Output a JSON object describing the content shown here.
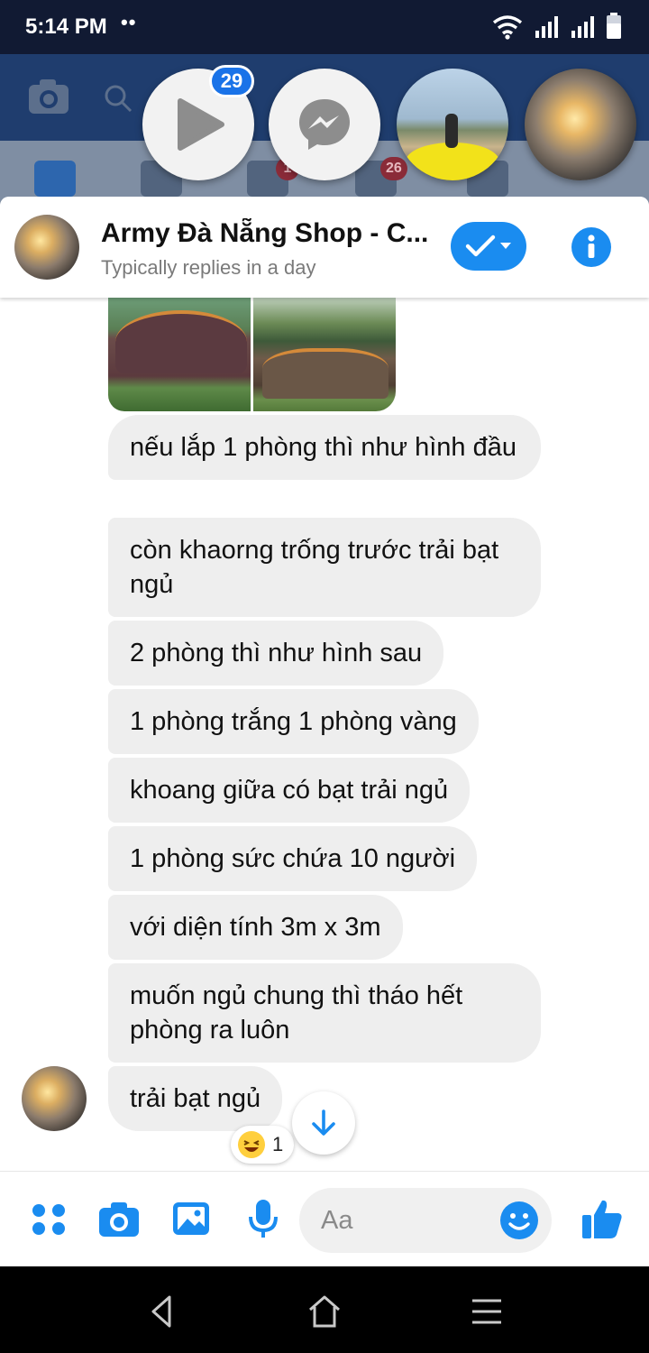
{
  "status_bar": {
    "time": "5:14 PM",
    "dots": "••"
  },
  "chat_heads": {
    "video_badge": "29"
  },
  "fb_tabs": {
    "badge_video": "",
    "badge_market": "1",
    "badge_notif": "26"
  },
  "chat": {
    "name": "Army Đà Nẵng Shop - C...",
    "status": "Typically replies in a day",
    "messages": [
      "nếu lắp 1 phòng thì như hình đầu",
      "còn khaorng trống trước trải bạt ngủ",
      "2 phòng thì như hình sau",
      "1 phòng trắng 1 phòng vàng",
      "khoang giữa có bạt trải ngủ",
      "1 phòng sức chứa 10 người",
      "với diện tính 3m x 3m",
      "muốn ngủ chung thì tháo hết phòng ra luôn",
      "trải bạt ngủ"
    ],
    "reaction_count": "1"
  },
  "composer": {
    "placeholder": "Aa"
  },
  "colors": {
    "accent": "#1a8cf0",
    "bubble": "#eeeeee"
  }
}
